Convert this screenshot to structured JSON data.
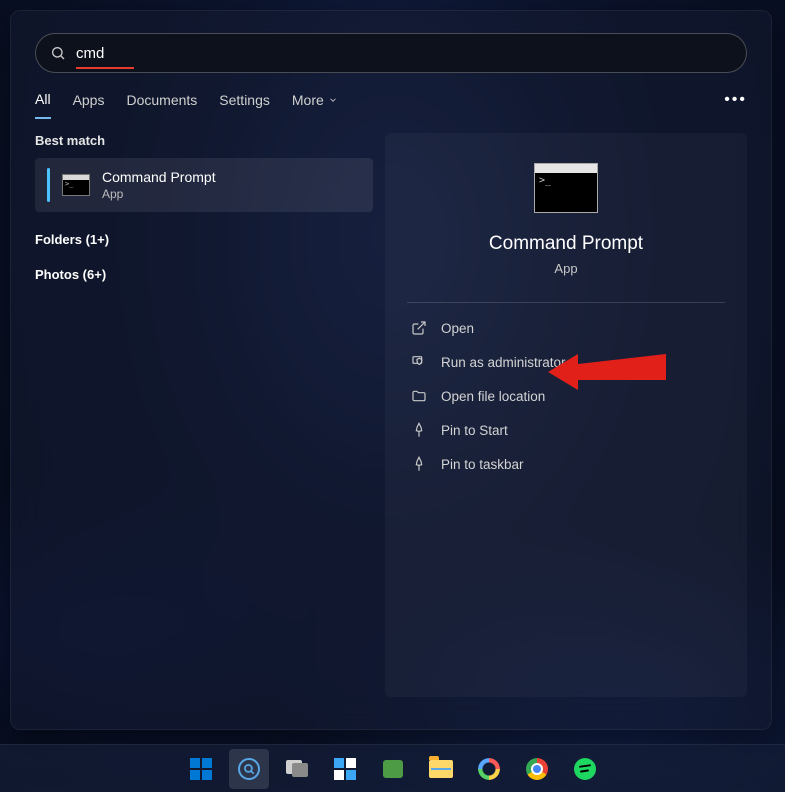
{
  "search": {
    "query": "cmd"
  },
  "tabs": {
    "items": [
      "All",
      "Apps",
      "Documents",
      "Settings",
      "More"
    ],
    "active_index": 0
  },
  "left": {
    "best_match_label": "Best match",
    "match": {
      "title": "Command Prompt",
      "subtitle": "App"
    },
    "groups": [
      {
        "label": "Folders (1+)"
      },
      {
        "label": "Photos (6+)"
      }
    ]
  },
  "preview": {
    "title": "Command Prompt",
    "subtitle": "App",
    "actions": [
      {
        "icon": "open-external-icon",
        "label": "Open"
      },
      {
        "icon": "shield-icon",
        "label": "Run as administrator"
      },
      {
        "icon": "folder-icon",
        "label": "Open file location"
      },
      {
        "icon": "pin-icon",
        "label": "Pin to Start"
      },
      {
        "icon": "pin-icon",
        "label": "Pin to taskbar"
      }
    ]
  },
  "taskbar": {
    "items": [
      {
        "name": "start-button",
        "kind": "start"
      },
      {
        "name": "search-button",
        "kind": "search",
        "active": true
      },
      {
        "name": "task-view-button",
        "kind": "taskview"
      },
      {
        "name": "widgets-button",
        "kind": "widgets"
      },
      {
        "name": "chat-button",
        "kind": "chat"
      },
      {
        "name": "file-explorer-button",
        "kind": "explorer"
      },
      {
        "name": "app-button-loop",
        "kind": "circlespin"
      },
      {
        "name": "chrome-button",
        "kind": "chrome"
      },
      {
        "name": "spotify-button",
        "kind": "spotify"
      }
    ]
  }
}
